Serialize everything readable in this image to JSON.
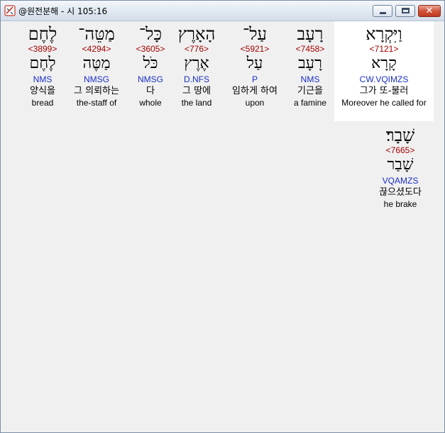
{
  "window": {
    "title": "@원전분해 - 시 105:16",
    "close_glyph": "✕"
  },
  "words": [
    {
      "hebrew": "וַיִּקְרָא",
      "strong": "<7121>",
      "root": "קָרָא",
      "morph": "CW.VQIMZS",
      "korean": "그가 또-불러",
      "english": "Moreover he called for"
    },
    {
      "hebrew": "רָעָב",
      "strong": "<7458>",
      "root": "רָעָב",
      "morph": "NMS",
      "korean": "기근을",
      "english": "a famine"
    },
    {
      "hebrew": "עַל־",
      "strong": "<5921>",
      "root": "עַל",
      "morph": "P",
      "korean": "임하게 하여",
      "english": "upon"
    },
    {
      "hebrew": "הָאָרֶץ",
      "strong": "<776>",
      "root": "אֶרֶץ",
      "morph": "D.NFS",
      "korean": "그 땅에",
      "english": "the land"
    },
    {
      "hebrew": "כָּל־",
      "strong": "<3605>",
      "root": "כֹּל",
      "morph": "NMSG",
      "korean": "다",
      "english": "whole"
    },
    {
      "hebrew": "מַטֵּה־",
      "strong": "<4294>",
      "root": "מַטֶּה",
      "morph": "NMSG",
      "korean": "그 의뢰하는",
      "english": "the-staff of"
    },
    {
      "hebrew": "לֶחֶם",
      "strong": "<3899>",
      "root": "לֶחֶם",
      "morph": "NMS",
      "korean": "양식을",
      "english": "bread"
    },
    {
      "hebrew": "שָׁבָר׃",
      "strong": "<7665>",
      "root": "שָׁבַר",
      "morph": "VQAMZS",
      "korean": "끊으셨도다",
      "english": "he brake"
    }
  ]
}
